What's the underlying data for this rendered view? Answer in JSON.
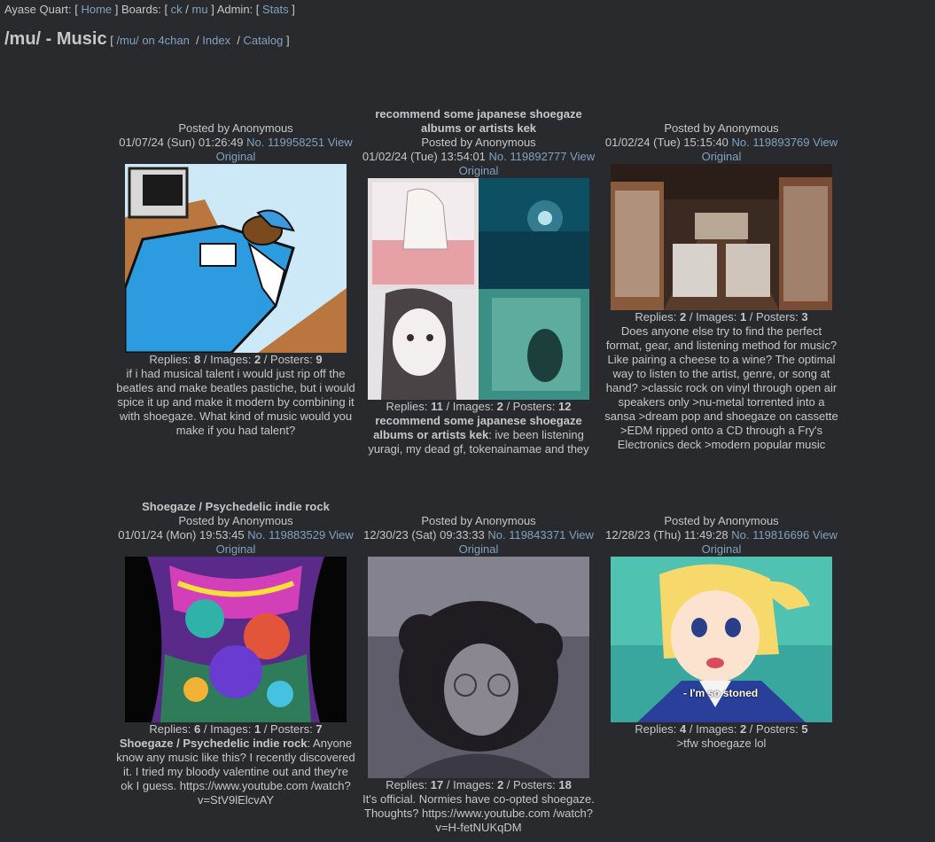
{
  "nav": {
    "site": "Ayase Quart:",
    "home": "Home",
    "boards_label": "Boards:",
    "boards": [
      "ck",
      "mu"
    ],
    "admin_label": "Admin:",
    "stats": "Stats"
  },
  "board": {
    "title": "/mu/ - Music",
    "link_4chan": "/mu/ on 4chan",
    "link_index": "Index",
    "link_catalog": "Catalog"
  },
  "threads": [
    {
      "subject": "",
      "poster": "Posted by Anonymous",
      "date": "01/07/24 (Sun) 01:26:49",
      "no_label": "No.",
      "no": "119958251",
      "view": "View Original",
      "thumb": "computer-bed-drawing",
      "replies": "8",
      "images": "2",
      "posters": "9",
      "teaser_subject": "",
      "teaser": "if i had musical talent i would just rip off the beatles and make beatles pastiche, but i would spice it up and make it modern by combining it with shoegaze. What kind of music would you make if you had talent?"
    },
    {
      "subject": "recommend some japanese shoegaze albums or artists kek",
      "poster": "Posted by Anonymous",
      "date": "01/02/24 (Tue) 13:54:01",
      "no_label": "No.",
      "no": "119892777",
      "view": "View Original",
      "thumb": "album-cover-collage",
      "replies": "11",
      "images": "2",
      "posters": "12",
      "teaser_subject": "recommend some japanese shoegaze albums or artists kek",
      "teaser": ": ive been listening yuragi, my dead gf, tokenainamae and they"
    },
    {
      "subject": "",
      "poster": "Posted by Anonymous",
      "date": "01/02/24 (Tue) 15:15:40",
      "no_label": "No.",
      "no": "119893769",
      "view": "View Original",
      "thumb": "record-store-photo",
      "replies": "2",
      "images": "1",
      "posters": "3",
      "teaser_subject": "",
      "teaser": "Does anyone else try to find the perfect format, gear, and listening method for music? Like pairing a cheese to a wine? The optimal way to listen to the artist, genre, or song at hand? >classic rock on vinyl through open air speakers only >nu-metal torrented into a sansa >dream pop and shoegaze on cassette >EDM ripped onto a CD through a Fry's Electronics deck >modern popular music through motif with mixed rank"
    },
    {
      "subject": "Shoegaze / Psychedelic indie rock",
      "poster": "Posted by Anonymous",
      "date": "01/01/24 (Mon) 19:53:45",
      "no_label": "No.",
      "no": "119883529",
      "view": "View Original",
      "thumb": "psychedelic-poster",
      "replies": "6",
      "images": "1",
      "posters": "7",
      "teaser_subject": "Shoegaze / Psychedelic indie rock",
      "teaser": ": Anyone know any music like this? I recently discovered it. I tried my bloody valentine out and they're ok I guess. https://www.youtube.com /watch?v=StV9lElcvAY"
    },
    {
      "subject": "",
      "poster": "Posted by Anonymous",
      "date": "12/30/23 (Sat) 09:33:33",
      "no_label": "No.",
      "no": "119843371",
      "view": "View Original",
      "thumb": "curly-hair-person-photo",
      "replies": "17",
      "images": "2",
      "posters": "18",
      "teaser_subject": "",
      "teaser": "It's official. Normies have co-opted shoegaze. Thoughts? https://www.youtube.com /watch?v=H-fetNUKqDM"
    },
    {
      "subject": "",
      "poster": "Posted by Anonymous",
      "date": "12/28/23 (Thu) 11:49:28",
      "no_label": "No.",
      "no": "119816696",
      "view": "View Original",
      "thumb": "anime-girl-screenshot",
      "thumb_caption": "- I'm so stoned",
      "replies": "4",
      "images": "2",
      "posters": "5",
      "teaser_subject": "",
      "teaser": ">tfw shoegaze lol"
    }
  ],
  "labels": {
    "replies": "Replies:",
    "images": " / Images:",
    "posters": " / Posters:"
  },
  "colors": {
    "background": "#282a2e",
    "text": "#c5c8c6",
    "link": "#81a2be"
  }
}
